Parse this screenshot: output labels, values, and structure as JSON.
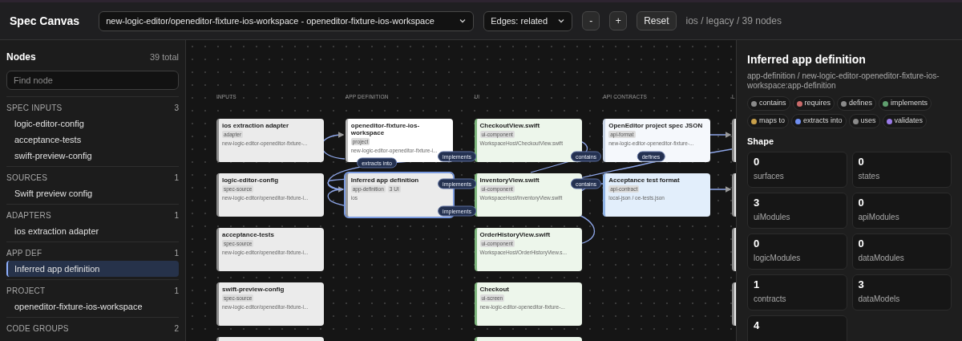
{
  "header": {
    "title": "Spec Canvas",
    "workspace_select": "new-logic-editor/openeditor-fixture-ios-workspace - openeditor-fixture-ios-workspace",
    "edges_select": "Edges: related",
    "buttons": [
      "-",
      "+",
      "Reset"
    ],
    "summary": "ios / legacy / 39 nodes"
  },
  "sidebar": {
    "title": "Nodes",
    "count": "39 total",
    "search": {
      "placeholder": "Find node"
    },
    "groups": [
      {
        "label": "SPEC INPUTS",
        "count": "3",
        "items": [
          {
            "label": "logic-editor-config",
            "selected": false
          },
          {
            "label": "acceptance-tests",
            "selected": false
          },
          {
            "label": "swift-preview-config",
            "selected": false
          }
        ]
      },
      {
        "label": "SOURCES",
        "count": "1",
        "items": [
          {
            "label": "Swift preview config",
            "selected": false
          }
        ]
      },
      {
        "label": "ADAPTERS",
        "count": "1",
        "items": [
          {
            "label": "ios extraction adapter",
            "selected": false
          }
        ]
      },
      {
        "label": "APP DEF",
        "count": "1",
        "items": [
          {
            "label": "Inferred app definition",
            "selected": true
          }
        ]
      },
      {
        "label": "PROJECT",
        "count": "1",
        "items": [
          {
            "label": "openeditor-fixture-ios-workspace",
            "selected": false
          }
        ]
      },
      {
        "label": "CODE GROUPS",
        "count": "2"
      }
    ]
  },
  "canvas": {
    "columns": [
      {
        "header": "INPUTS",
        "nodes": [
          {
            "kind": "input",
            "title": "ios extraction adapter",
            "tags": [
              "adapter"
            ],
            "subtitle": "new-logic-editor-openeditor-fixture-...",
            "selected": false
          },
          {
            "kind": "input",
            "title": "logic-editor-config",
            "tags": [
              "spec-source"
            ],
            "subtitle": "new-logic-editor/openeditor-fixture-i...",
            "selected": false
          },
          {
            "kind": "input",
            "title": "acceptance-tests",
            "tags": [
              "spec-source"
            ],
            "subtitle": "new-logic-editor/openeditor-fixture-i...",
            "selected": false
          },
          {
            "kind": "input",
            "title": "swift-preview-config",
            "tags": [
              "spec-source"
            ],
            "subtitle": "new-logic-editor/openeditor-fixture-i...",
            "selected": false
          },
          {
            "kind": "input",
            "selected": false
          }
        ]
      },
      {
        "header": "APP DEFINITION",
        "nodes": [
          {
            "kind": "project",
            "title": "openeditor-fixture-ios-workspace",
            "tags": [
              "project"
            ],
            "subtitle": "new-logic-editor-openeditor-fixture-i...",
            "selected": false
          },
          {
            "kind": "app",
            "title": "Inferred app definition",
            "tags": [
              "app-definition",
              "3 UI"
            ],
            "subtitle": "ios",
            "selected": true
          }
        ]
      },
      {
        "header": "UI",
        "nodes": [
          {
            "kind": "ui",
            "title": "CheckoutView.swift",
            "tags": [
              "ui-component"
            ],
            "subtitle": "WorkspaceHost/CheckoutView.swift",
            "selected": false
          },
          {
            "kind": "ui",
            "title": "InventoryView.swift",
            "tags": [
              "ui-component"
            ],
            "subtitle": "WorkspaceHost/InventoryView.swift",
            "selected": false
          },
          {
            "kind": "ui",
            "title": "OrderHistoryView.swift",
            "tags": [
              "ui-component"
            ],
            "subtitle": "WorkspaceHost/OrderHistoryView.s...",
            "selected": false
          },
          {
            "kind": "ui",
            "title": "Checkout",
            "tags": [
              "ui-screen"
            ],
            "subtitle": "new-logic-editor-openeditor-fixture-...",
            "selected": false
          },
          {
            "kind": "ui",
            "selected": false
          }
        ]
      },
      {
        "header": "API CONTRACTS",
        "nodes": [
          {
            "kind": "api",
            "title": "OpenEditor project spec JSON",
            "tags": [
              "api-format"
            ],
            "subtitle": "new-logic-editor-openeditor-fixture-...",
            "selected": false
          },
          {
            "kind": "contract",
            "title": "Acceptance test format",
            "tags": [
              "api-contract"
            ],
            "subtitle": "local-json / oe-tests.json",
            "selected": false
          }
        ]
      },
      {
        "header": "L",
        "nodes": [
          {
            "kind": "input",
            "selected": false
          },
          {
            "kind": "input",
            "selected": false
          },
          {
            "kind": "input",
            "selected": false
          },
          {
            "kind": "input",
            "selected": false
          }
        ]
      }
    ],
    "edges": [
      {
        "label": "extracts into"
      },
      {
        "label": "implements"
      },
      {
        "label": "implements"
      },
      {
        "label": "implements"
      },
      {
        "label": "contains"
      },
      {
        "label": "contains"
      },
      {
        "label": "defines"
      }
    ]
  },
  "details": {
    "title": "Inferred app definition",
    "subtitle": "app-definition / new-logic-editor-openeditor-fixture-ios-workspace:app-definition",
    "legend": [
      {
        "label": "contains",
        "color": "#8a8a8a"
      },
      {
        "label": "requires",
        "color": "#c96a6a"
      },
      {
        "label": "defines",
        "color": "#8a8a8a"
      },
      {
        "label": "implements",
        "color": "#5f9e6e"
      },
      {
        "label": "maps to",
        "color": "#c9a04a"
      },
      {
        "label": "extracts into",
        "color": "#6f8ef0"
      },
      {
        "label": "uses",
        "color": "#8a8a8a"
      },
      {
        "label": "validates",
        "color": "#9a7ae8"
      }
    ],
    "shape_title": "Shape",
    "stats": [
      {
        "value": "0",
        "label": "surfaces"
      },
      {
        "value": "0",
        "label": "states"
      },
      {
        "value": "3",
        "label": "uiModules"
      },
      {
        "value": "0",
        "label": "apiModules"
      },
      {
        "value": "0",
        "label": "logicModules"
      },
      {
        "value": "0",
        "label": "dataModules"
      },
      {
        "value": "1",
        "label": "contracts"
      },
      {
        "value": "3",
        "label": "dataModels"
      },
      {
        "value": "4"
      }
    ]
  }
}
